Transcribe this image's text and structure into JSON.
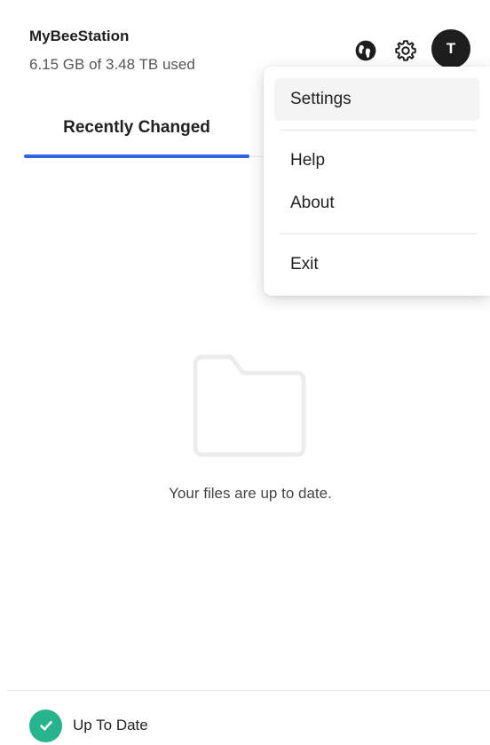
{
  "header": {
    "app_name": "MyBeeStation",
    "storage_used": "6.15 GB of 3.48 TB used",
    "avatar_initial": "T"
  },
  "tabs": [
    {
      "label": "Recently Changed",
      "active": true
    }
  ],
  "empty_state": {
    "message": "Your files are up to date.",
    "icon": "folder-icon"
  },
  "menu": {
    "items": [
      {
        "label": "Settings",
        "highlighted": true
      },
      {
        "label": "Help"
      },
      {
        "label": "About"
      },
      {
        "label": "Exit"
      }
    ]
  },
  "status": {
    "label": "Up To Date",
    "icon": "check-circle-icon",
    "color": "#27b48c"
  },
  "colors": {
    "accent": "#2f66e0",
    "avatar_bg": "#1e1e1e"
  }
}
